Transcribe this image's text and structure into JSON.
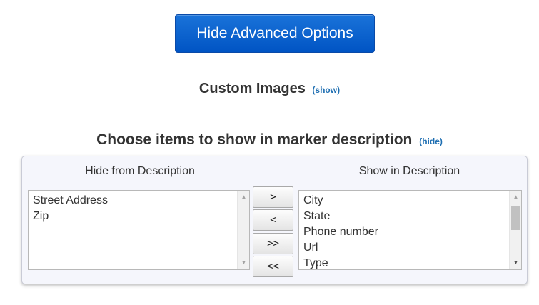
{
  "advanced_button": {
    "label": "Hide Advanced Options"
  },
  "custom_images": {
    "title": "Custom Images",
    "toggle": "(show)"
  },
  "marker_description": {
    "title": "Choose items to show in marker description",
    "toggle": "(hide)",
    "hide_column": {
      "label": "Hide from Description",
      "items": [
        "Street Address",
        "Zip"
      ]
    },
    "show_column": {
      "label": "Show in Description",
      "items": [
        "City",
        "State",
        "Phone number",
        "Url",
        "Type"
      ]
    },
    "buttons": {
      "add": ">",
      "remove": "<",
      "add_all": ">>",
      "remove_all": "<<"
    }
  },
  "colors": {
    "primary": "#0054c4",
    "link": "#1f6fb2",
    "panel_bg": "#f5f6fc"
  }
}
